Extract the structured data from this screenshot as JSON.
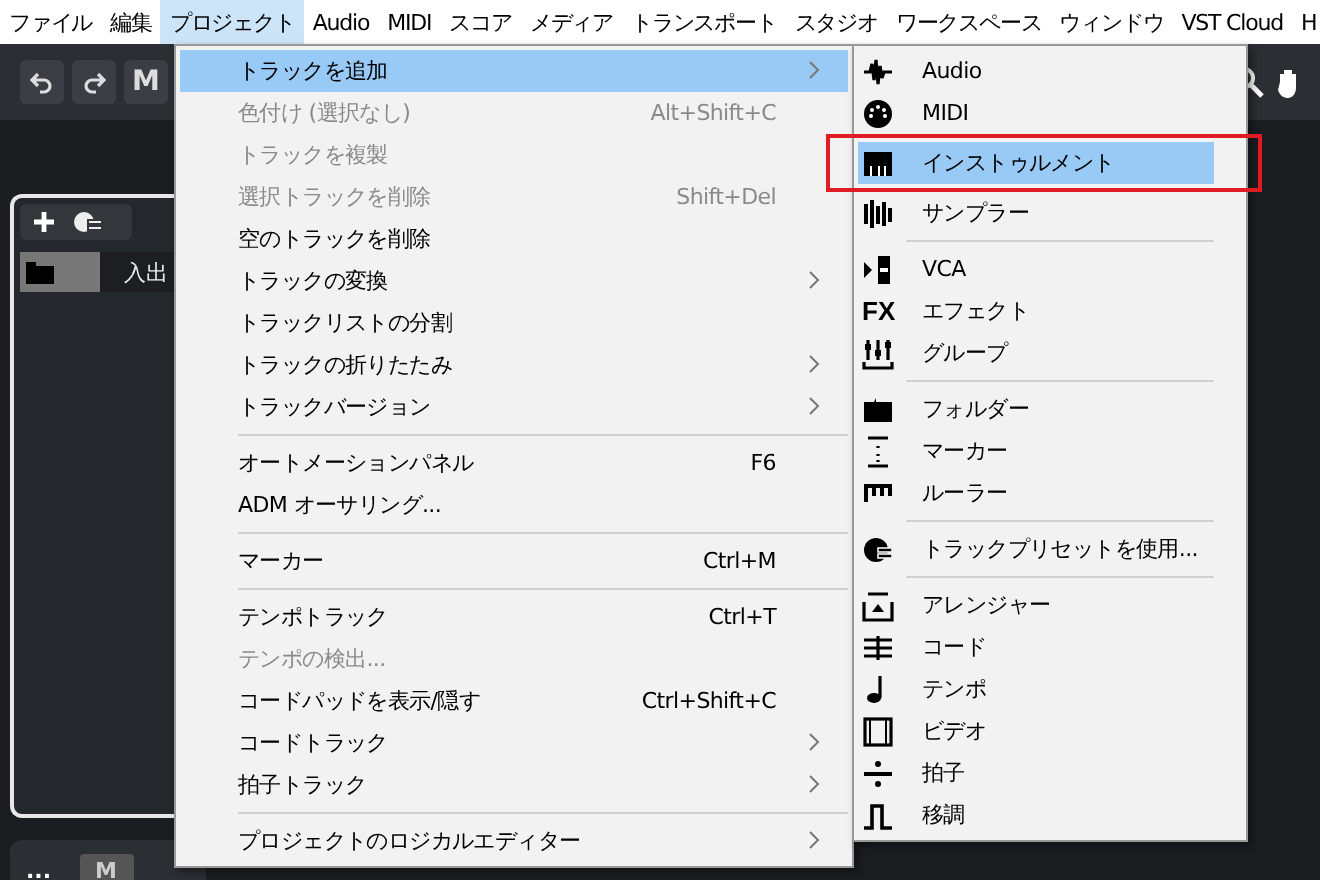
{
  "menubar": [
    {
      "label": "ファイル",
      "selected": false
    },
    {
      "label": "編集",
      "selected": false
    },
    {
      "label": "プロジェクト",
      "selected": true
    },
    {
      "label": "Audio",
      "selected": false
    },
    {
      "label": "MIDI",
      "selected": false
    },
    {
      "label": "スコア",
      "selected": false
    },
    {
      "label": "メディア",
      "selected": false
    },
    {
      "label": "トランスポート",
      "selected": false
    },
    {
      "label": "スタジオ",
      "selected": false
    },
    {
      "label": "ワークスペース",
      "selected": false
    },
    {
      "label": "ウィンドウ",
      "selected": false
    },
    {
      "label": "VST Cloud",
      "selected": false
    },
    {
      "label": "H",
      "selected": false
    }
  ],
  "toolbar": {
    "mode_button": "M"
  },
  "track_panel": {
    "folder_row_label": "入出"
  },
  "bottom_bar": {
    "more_button": "...",
    "mode_button": "M"
  },
  "project_menu": [
    {
      "kind": "item",
      "label": "トラックを追加",
      "submenu": true,
      "disabled": false,
      "selected": true
    },
    {
      "kind": "item",
      "label": "色付け (選択なし)",
      "shortcut": "Alt+Shift+C",
      "submenu": false,
      "disabled": true,
      "selected": false
    },
    {
      "kind": "item",
      "label": "トラックを複製",
      "submenu": false,
      "disabled": true,
      "selected": false
    },
    {
      "kind": "item",
      "label": "選択トラックを削除",
      "shortcut": "Shift+Del",
      "submenu": false,
      "disabled": true,
      "selected": false
    },
    {
      "kind": "item",
      "label": "空のトラックを削除",
      "submenu": false,
      "disabled": false,
      "selected": false
    },
    {
      "kind": "item",
      "label": "トラックの変換",
      "submenu": true,
      "disabled": false,
      "selected": false
    },
    {
      "kind": "item",
      "label": "トラックリストの分割",
      "submenu": false,
      "disabled": false,
      "selected": false
    },
    {
      "kind": "item",
      "label": "トラックの折りたたみ",
      "submenu": true,
      "disabled": false,
      "selected": false
    },
    {
      "kind": "item",
      "label": "トラックバージョン",
      "submenu": true,
      "disabled": false,
      "selected": false
    },
    {
      "kind": "separator"
    },
    {
      "kind": "item",
      "label": "オートメーションパネル",
      "shortcut": "F6",
      "submenu": false,
      "disabled": false,
      "selected": false
    },
    {
      "kind": "item",
      "label": "ADM オーサリング...",
      "submenu": false,
      "disabled": false,
      "selected": false
    },
    {
      "kind": "separator"
    },
    {
      "kind": "item",
      "label": "マーカー",
      "shortcut": "Ctrl+M",
      "submenu": false,
      "disabled": false,
      "selected": false
    },
    {
      "kind": "separator"
    },
    {
      "kind": "item",
      "label": "テンポトラック",
      "shortcut": "Ctrl+T",
      "submenu": false,
      "disabled": false,
      "selected": false
    },
    {
      "kind": "item",
      "label": "テンポの検出...",
      "submenu": false,
      "disabled": true,
      "selected": false
    },
    {
      "kind": "item",
      "label": "コードパッドを表示/隠す",
      "shortcut": "Ctrl+Shift+C",
      "submenu": false,
      "disabled": false,
      "selected": false
    },
    {
      "kind": "item",
      "label": "コードトラック",
      "submenu": true,
      "disabled": false,
      "selected": false
    },
    {
      "kind": "item",
      "label": "拍子トラック",
      "submenu": true,
      "disabled": false,
      "selected": false
    },
    {
      "kind": "separator"
    },
    {
      "kind": "item",
      "label": "プロジェクトのロジカルエディター",
      "submenu": true,
      "disabled": false,
      "selected": false
    }
  ],
  "add_track_submenu": [
    {
      "kind": "item",
      "label": "Audio",
      "selected": false,
      "highlighted": false
    },
    {
      "kind": "item",
      "label": "MIDI",
      "selected": false,
      "highlighted": false
    },
    {
      "kind": "item",
      "label": "インストゥルメント",
      "selected": true,
      "highlighted": true
    },
    {
      "kind": "item",
      "label": "サンプラー",
      "selected": false,
      "highlighted": false
    },
    {
      "kind": "separator"
    },
    {
      "kind": "item",
      "label": "VCA",
      "selected": false,
      "highlighted": false
    },
    {
      "kind": "item",
      "label": "エフェクト",
      "icon_text": "FX",
      "selected": false,
      "highlighted": false
    },
    {
      "kind": "item",
      "label": "グループ",
      "selected": false,
      "highlighted": false
    },
    {
      "kind": "separator"
    },
    {
      "kind": "item",
      "label": "フォルダー",
      "selected": false,
      "highlighted": false
    },
    {
      "kind": "item",
      "label": "マーカー",
      "selected": false,
      "highlighted": false
    },
    {
      "kind": "item",
      "label": "ルーラー",
      "selected": false,
      "highlighted": false
    },
    {
      "kind": "separator"
    },
    {
      "kind": "item",
      "label": "トラックプリセットを使用...",
      "selected": false,
      "highlighted": false
    },
    {
      "kind": "separator"
    },
    {
      "kind": "item",
      "label": "アレンジャー",
      "selected": false,
      "highlighted": false
    },
    {
      "kind": "item",
      "label": "コード",
      "selected": false,
      "highlighted": false
    },
    {
      "kind": "item",
      "label": "テンポ",
      "selected": false,
      "highlighted": false
    },
    {
      "kind": "item",
      "label": "ビデオ",
      "selected": false,
      "highlighted": false
    },
    {
      "kind": "item",
      "label": "拍子",
      "selected": false,
      "highlighted": false
    },
    {
      "kind": "item",
      "label": "移調",
      "selected": false,
      "highlighted": false
    }
  ]
}
